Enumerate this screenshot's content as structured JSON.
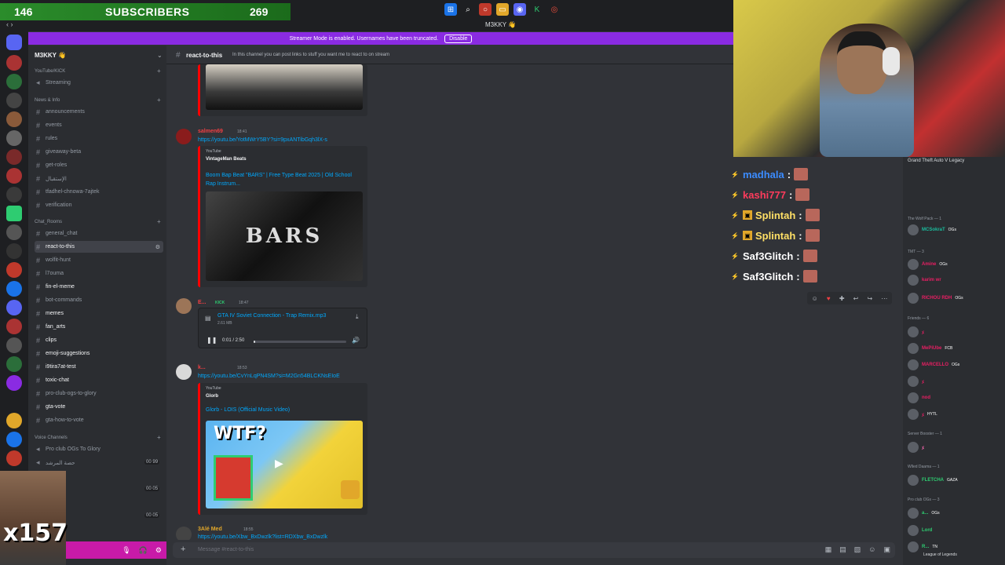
{
  "overlay_top": {
    "subscriber_count": "146",
    "subscriber_label": "SUBSCRIBERS",
    "subscriber_goal": "269"
  },
  "window": {
    "server_title": "M3KKY 👋"
  },
  "banner": {
    "text": "Streamer Mode is enabled. Usernames have been truncated.",
    "button": "Disable"
  },
  "server": {
    "name": "M3KKY 👋",
    "categories": [
      {
        "label": "YouTube/KICK",
        "channels": [
          {
            "label": "Streaming"
          }
        ]
      },
      {
        "label": "News & Info",
        "channels": [
          {
            "label": "announcements"
          },
          {
            "label": "events"
          },
          {
            "label": "rules"
          },
          {
            "label": "giveaway-beta"
          },
          {
            "label": "get-roles"
          },
          {
            "label": "الإستقبال"
          },
          {
            "label": "tfadhel-chnowa-7ajtek"
          },
          {
            "label": "verification"
          }
        ]
      },
      {
        "label": "Chat_Rooms",
        "channels": [
          {
            "label": "general_chat"
          },
          {
            "label": "react-to-this"
          },
          {
            "label": "wolfit-hunt"
          },
          {
            "label": "l7ouma"
          },
          {
            "label": "fin-el-meme"
          },
          {
            "label": "bot-commands"
          },
          {
            "label": "memes"
          },
          {
            "label": "fan_arts"
          },
          {
            "label": "clips"
          },
          {
            "label": "emoji-suggestions"
          },
          {
            "label": "i9tira7at-test"
          },
          {
            "label": "toxic-chat"
          },
          {
            "label": "pro-club-ogs-to-glory"
          },
          {
            "label": "gta-vote"
          },
          {
            "label": "gta-how-to-vote"
          }
        ]
      },
      {
        "label": "Voice Channels",
        "channels": [
          {
            "label": "Pro club OGs To Glory"
          },
          {
            "label": "حصة المرشد"
          }
        ]
      }
    ],
    "voice_counts": [
      "00",
      "99",
      "00",
      "05",
      "00",
      "05"
    ]
  },
  "webcam_badge": "x157",
  "channel": {
    "name": "react-to-this",
    "topic": "In this channel you can post links to stuff you want me to react to on stream"
  },
  "messages": [
    {
      "author": "salmen69",
      "time": "18:41",
      "link": "https://youtu.be/YotMWrY5BY?si=9pxANTibGqh3lX-s",
      "embed_source": "YouTube",
      "embed_author": "VintageMan Beats",
      "embed_title": "Boom Bap Beat \"BARS\" | Free Type Beat 2025 | Old School Rap Instrum...",
      "thumb_text": "BARS"
    },
    {
      "author": "E...",
      "badge": "KICK",
      "time": "18:47",
      "audio_file": "GTA IV Soviet Connection - Trap Remix.mp3",
      "audio_size": "2.61 MB",
      "audio_time": "0:01 / 2:50",
      "audio_progress": 0.01
    },
    {
      "author": "k...",
      "time": "18:53",
      "link": "https://youtu.be/CvYnLqPN4SM?si=M2Gn54BLCKNsEIoE",
      "embed_source": "YouTube",
      "embed_author": "Glorb",
      "embed_title": "Glorb - LOIS (Official Music Video)",
      "thumb_text": "WTF?"
    },
    {
      "author": "3Alé Med",
      "time": "18:55",
      "link": "https://youtu.be/Xbw_BxDwzlk?list=RDXbw_BxDwzlk"
    }
  ],
  "input": {
    "placeholder": "Message #react-to-this"
  },
  "stream_chat": [
    {
      "name": "madhala",
      "color": "#3b8cff"
    },
    {
      "name": "kashi777",
      "color": "#ff3b5c"
    },
    {
      "name": "Splintah",
      "color": "#ffe066"
    },
    {
      "name": "Splintah",
      "color": "#ffe066"
    },
    {
      "name": "Saf3Glitch",
      "color": "#ffffff"
    },
    {
      "name": "Saf3Glitch",
      "color": "#ffffff"
    }
  ],
  "members": {
    "activity_top": "Grand Theft Auto V Legacy",
    "groups": [
      {
        "label": "The Wolf Pack — 1"
      },
      {
        "label": "TMT — 3"
      },
      {
        "label": "Friends — 6"
      },
      {
        "label": "Server Booster — 1"
      },
      {
        "label": "Wlled Daama — 1"
      },
      {
        "label": "Pro club OGs — 3"
      }
    ],
    "entries": [
      {
        "name": "MCSokraT",
        "tag": "OGs",
        "color": "#1abc9c"
      },
      {
        "name": "Amine",
        "tag": "OGs",
        "color": "#e91e63"
      },
      {
        "name": "karim wr",
        "tag": "",
        "color": "#e91e63"
      },
      {
        "name": "RICHOU RDH",
        "tag": "OGs",
        "color": "#e91e63"
      },
      {
        "name": "ﾒ",
        "tag": "",
        "color": "#e91e63"
      },
      {
        "name": "MePiUbe",
        "tag": "FCB",
        "color": "#e91e63"
      },
      {
        "name": "MARCELLO",
        "tag": "OGs",
        "color": "#e91e63"
      },
      {
        "name": "ﾒ",
        "tag": "",
        "color": "#e91e63"
      },
      {
        "name": "nod",
        "tag": "",
        "color": "#e91e63"
      },
      {
        "name": "ﾒ",
        "tag": "HYTL",
        "color": "#e91e63"
      },
      {
        "name": "ﾒ",
        "tag": "",
        "color": "#ff69b4"
      },
      {
        "name": "FLETCHA",
        "tag": "GAZA",
        "color": "#2ecc71"
      },
      {
        "name": "a...",
        "tag": "OGs",
        "color": "#2ecc71"
      },
      {
        "name": "Lord",
        "tag": "",
        "color": "#2ecc71"
      },
      {
        "name": "R...",
        "tag": "TN",
        "color": "#2ecc71"
      }
    ],
    "sub_activity": "League of Legends"
  },
  "colors": {
    "accent": "#8a2be2",
    "link": "#00a8fc",
    "embed_border": "#ff0000",
    "subs_bar": "#2b8c2b"
  }
}
